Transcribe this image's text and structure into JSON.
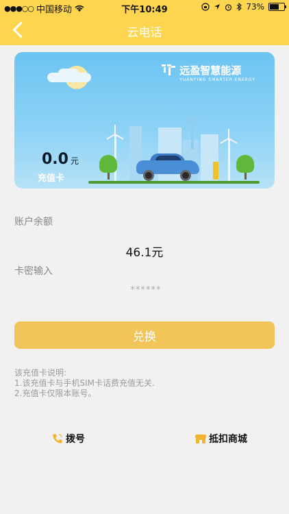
{
  "status_bar": {
    "signal": "●●●○○",
    "carrier": "中国移动",
    "time": "下午10:49",
    "battery": "73%",
    "battery_level": 0.73
  },
  "header": {
    "title": "云电话"
  },
  "card": {
    "brand_name": "远盈智慧能源",
    "brand_subtitle": "YUANYING SMARTER ENERGY",
    "amount": "0.0",
    "amount_unit": "元",
    "label": "充值卡"
  },
  "account": {
    "balance_label": "账户余额",
    "balance_value": "46.1元"
  },
  "card_pin": {
    "label": "卡密输入",
    "placeholder": "******"
  },
  "redeem_button": "兑换",
  "notes": {
    "title": "该充值卡说明:",
    "items": [
      "1.该充值卡与手机SIM卡话费充值无关.",
      "2.充值卡仅限本账号。"
    ]
  },
  "bottom_links": {
    "dial": "拨号",
    "shop": "抵扣商城"
  },
  "colors": {
    "header": "#fdd54f",
    "button": "#f2c55b",
    "icon_accent": "#f1b42f"
  }
}
